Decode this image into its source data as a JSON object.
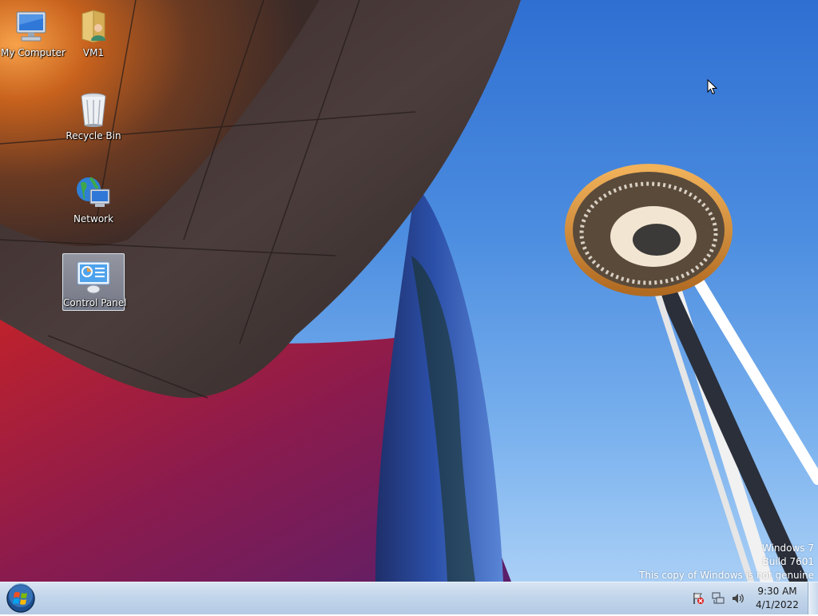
{
  "desktop": {
    "icons": [
      {
        "label": "My Computer",
        "icon": "computer-icon"
      },
      {
        "label": "VM1",
        "icon": "user-folder-icon"
      },
      {
        "label": "Recycle Bin",
        "icon": "recycle-bin-icon"
      },
      {
        "label": "Network",
        "icon": "network-icon"
      },
      {
        "label": "Control Panel",
        "icon": "control-panel-icon",
        "selected": true
      }
    ],
    "watermark": {
      "line1": "Windows 7",
      "line2": "Build 7601",
      "line3": "This copy of Windows is not genuine"
    }
  },
  "taskbar": {
    "start_icon": "windows-orb-icon",
    "tray_icons": [
      "action-center-flag-icon",
      "network-status-icon",
      "volume-icon"
    ],
    "clock": {
      "time": "9:30 AM",
      "date": "4/1/2022"
    }
  }
}
